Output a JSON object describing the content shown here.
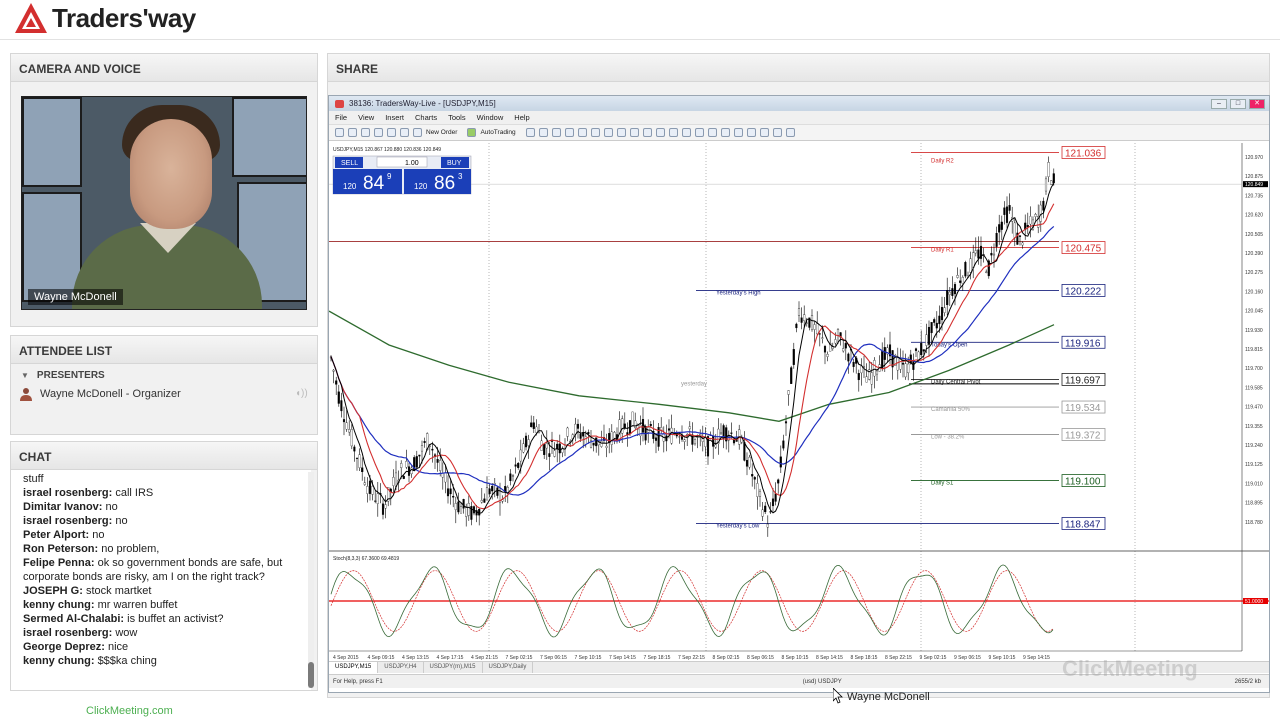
{
  "brand": {
    "name": "Traders'way",
    "color": "#d32f2f"
  },
  "camera": {
    "title": "CAMERA AND VOICE",
    "presenter_name": "Wayne McDonell"
  },
  "attendees": {
    "title": "ATTENDEE LIST",
    "group": "PRESENTERS",
    "presenter": "Wayne McDonell - Organizer"
  },
  "chat": {
    "title": "CHAT",
    "messages": [
      {
        "user": "",
        "text": "stuff"
      },
      {
        "user": "israel rosenberg:",
        "text": "call   IRS"
      },
      {
        "user": "Dimitar Ivanov:",
        "text": "no"
      },
      {
        "user": "israel rosenberg:",
        "text": "no"
      },
      {
        "user": "Peter Alport:",
        "text": "no"
      },
      {
        "user": "Ron Peterson:",
        "text": "no problem,"
      },
      {
        "user": "Felipe Penna:",
        "text": "ok so government bonds are safe, but corporate bonds are risky, am I on the right track?"
      },
      {
        "user": "JOSEPH G:",
        "text": "stock martket"
      },
      {
        "user": "kenny chung:",
        "text": "mr warren buffet"
      },
      {
        "user": "Sermed Al-Chalabi:",
        "text": "is buffet an activist?"
      },
      {
        "user": "israel rosenberg:",
        "text": "wow"
      },
      {
        "user": "George Deprez:",
        "text": "nice"
      },
      {
        "user": "kenny chung:",
        "text": "$$$ka ching"
      }
    ]
  },
  "footer": {
    "link": "ClickMeeting.com"
  },
  "share": {
    "title": "SHARE",
    "watermark": "ClickMeeting",
    "cursor_label": "Wayne McDonell"
  },
  "mt4": {
    "window_title": "38136: TradersWay-Live - [USDJPY,M15]",
    "menu": [
      "File",
      "View",
      "Insert",
      "Charts",
      "Tools",
      "Window",
      "Help"
    ],
    "toolbar_labels": [
      "New Order",
      "AutoTrading"
    ],
    "symbol_info": "USDJPY,M15  120.867 120.880 120.836 120.849",
    "sell_label": "SELL",
    "buy_label": "BUY",
    "lot": "1.00",
    "sell_price_big": "84",
    "sell_price_small": "120",
    "sell_price_sup": "9",
    "buy_price_big": "86",
    "buy_price_small": "120",
    "buy_price_sup": "3",
    "levels": [
      {
        "label": "Daily R2",
        "price": "121.036",
        "color": "#d32f2f"
      },
      {
        "label": "Daily R1",
        "price": "120.475",
        "color": "#d32f2f"
      },
      {
        "label": "Yesterday's High",
        "price": "120.222",
        "color": "#1a237e"
      },
      {
        "label": "Today's Open",
        "price": "119.916",
        "color": "#1a237e"
      },
      {
        "label": "Daily Central Pivot",
        "price": "119.697",
        "color": "#222"
      },
      {
        "label": "Camarilla 50%",
        "price": "119.534",
        "color": "#999"
      },
      {
        "label": "Low - 38.2%",
        "price": "119.372",
        "color": "#999"
      },
      {
        "label": "Daily S1",
        "price": "119.100",
        "color": "#1b5e20"
      },
      {
        "label": "Yesterday's Low",
        "price": "118.847",
        "color": "#1a237e"
      }
    ],
    "axis_prices": [
      "120.970",
      "120.875",
      "120.735",
      "120.620",
      "120.505",
      "120.390",
      "120.275",
      "120.160",
      "120.045",
      "119.930",
      "119.815",
      "119.700",
      "119.585",
      "119.470",
      "119.355",
      "119.240",
      "119.125",
      "119.010",
      "118.895",
      "118.780"
    ],
    "time_labels": [
      "4 Sep 2015",
      "4 Sep 09:15",
      "4 Sep 13:15",
      "4 Sep 17:15",
      "4 Sep 21:15",
      "7 Sep 02:15",
      "7 Sep 06:15",
      "7 Sep 10:15",
      "7 Sep 14:15",
      "7 Sep 18:15",
      "7 Sep 22:15",
      "8 Sep 02:15",
      "8 Sep 06:15",
      "8 Sep 10:15",
      "8 Sep 14:15",
      "8 Sep 18:15",
      "8 Sep 22:15",
      "9 Sep 02:15",
      "9 Sep 06:15",
      "9 Sep 10:15",
      "9 Sep 14:15"
    ],
    "stoch_label": "Stoch(8,3,3) 67.3600 69.4819",
    "stoch_level": "51.0000",
    "annotation_yesterday": "yesterday",
    "tabs": [
      "USDJPY,M15",
      "USDJPY,H4",
      "USDJPY(m),M15",
      "USDJPY,Daily"
    ],
    "status_left": "For Help, press F1",
    "status_mid": "(usd) USDJPY",
    "status_right": "2655/2 kb",
    "current_price": "120.849"
  }
}
